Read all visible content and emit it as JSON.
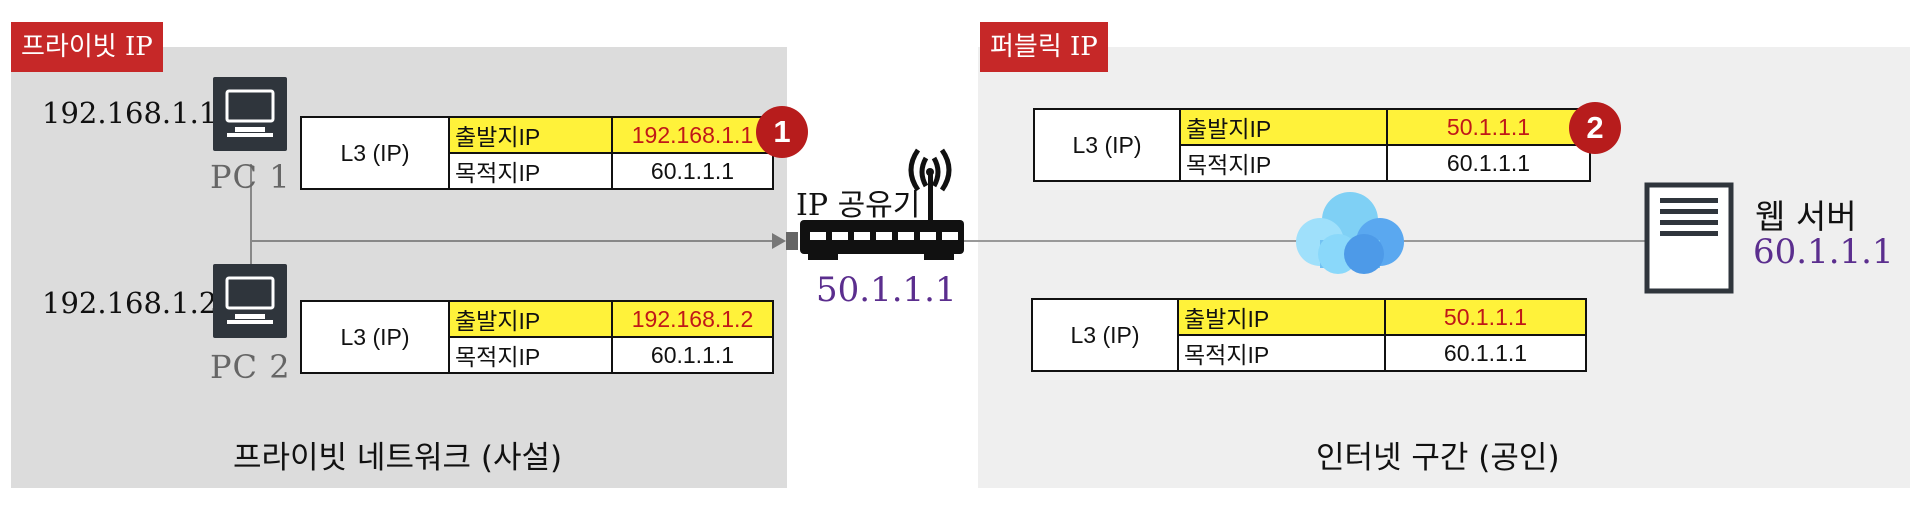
{
  "colors": {
    "tag_red": "#c62828",
    "zone_private": "#dcdcdc",
    "zone_public": "#efefef",
    "highlight": "#fff23a",
    "purple": "#5b2e8e"
  },
  "private": {
    "tag": "프라이빗 IP",
    "caption": "프라이빗 네트워크 (사설)",
    "pc1": {
      "ip": "192.168.1.1",
      "label": "PC 1"
    },
    "pc2": {
      "ip": "192.168.1.2",
      "label": "PC 2"
    },
    "packet1": {
      "layer": "L3 (IP)",
      "src_label": "출발지IP",
      "src_value": "192.168.1.1",
      "dst_label": "목적지IP",
      "dst_value": "60.1.1.1",
      "badge": "1"
    },
    "packet2": {
      "layer": "L3 (IP)",
      "src_label": "출발지IP",
      "src_value": "192.168.1.2",
      "dst_label": "목적지IP",
      "dst_value": "60.1.1.1"
    }
  },
  "router": {
    "label": "IP 공유기",
    "ip": "50.1.1.1",
    "icon": "router-icon"
  },
  "public": {
    "tag": "퍼블릭 IP",
    "caption": "인터넷 구간 (공인)",
    "packet1": {
      "layer": "L3 (IP)",
      "src_label": "출발지IP",
      "src_value": "50.1.1.1",
      "dst_label": "목적지IP",
      "dst_value": "60.1.1.1",
      "badge": "2"
    },
    "packet2": {
      "layer": "L3 (IP)",
      "src_label": "출발지IP",
      "src_value": "50.1.1.1",
      "dst_label": "목적지IP",
      "dst_value": "60.1.1.1"
    },
    "server": {
      "label": "웹 서버",
      "ip": "60.1.1.1",
      "icon": "server-icon"
    },
    "cloud_icon": "cloud-icon"
  }
}
